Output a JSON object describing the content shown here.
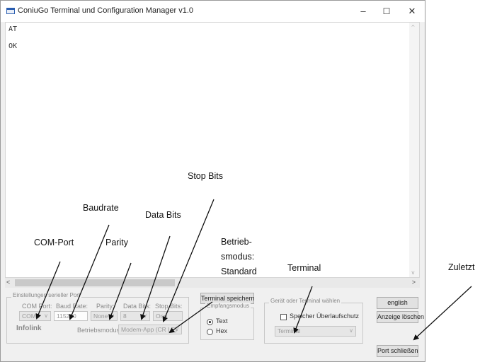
{
  "window": {
    "title": "ConiuGo Terminal und Configuration Manager v1.0",
    "minimize": "–",
    "maximize": "☐",
    "close": "✕"
  },
  "terminal": {
    "lines": [
      "AT",
      "OK"
    ]
  },
  "serial": {
    "group_title": "Einstellungen serieller Port",
    "com_port_label": "COM Port:",
    "com_port_value": "COM3",
    "baud_label": "Baud Rate:",
    "baud_value": "115200",
    "parity_label": "Parity:",
    "parity_value": "None",
    "databits_label": "Data Bits:",
    "databits_value": "8",
    "stopbits_label": "Stop Bits:",
    "stopbits_value": "One",
    "infolink": "Infolink",
    "mode_label": "Betriebsmodus:",
    "mode_value": "Modem-App",
    "mode_value2": "(CR LF)"
  },
  "receive": {
    "save_button": "Terminal speichern",
    "group_title": "Empfangsmodus",
    "text_option": "Text",
    "hex_option": "Hex",
    "selected": "Text"
  },
  "device": {
    "group_title": "Gerät oder Terminal wählen",
    "protect_label": "Speicher Überlaufschutz",
    "select_value": "Terminal"
  },
  "buttons": {
    "english": "english",
    "clear": "Anzeige löschen",
    "close_port": "Port schließen"
  },
  "annotations": {
    "com_port": "COM-Port",
    "baudrate": "Baudrate",
    "parity": "Parity",
    "data_bits": "Data Bits",
    "stop_bits": "Stop Bits",
    "mode_line1": "Betrieb-",
    "mode_line2": "smodus:",
    "mode_line3": "Standard",
    "terminal": "Terminal",
    "last": "Zuletzt"
  }
}
